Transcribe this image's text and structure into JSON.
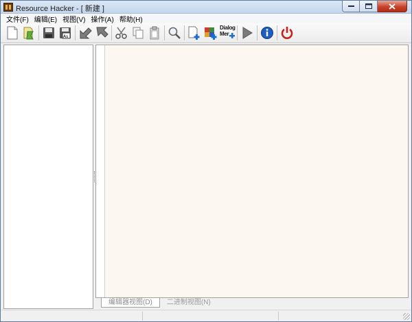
{
  "window": {
    "title": "Resource Hacker - [ 新建 ]"
  },
  "menu": [
    {
      "label": "文件(F)"
    },
    {
      "label": "编辑(E)"
    },
    {
      "label": "视图(V)"
    },
    {
      "label": "操作(A)"
    },
    {
      "label": "帮助(H)"
    }
  ],
  "toolbar": {
    "dialog_menu_line1": "Dialog",
    "dialog_menu_line2": "Mer",
    "icons": [
      "new-file-icon",
      "open-file-icon",
      "save-icon",
      "save-as-icon",
      "back-arrow-icon",
      "forward-arrow-icon",
      "cut-icon",
      "copy-icon",
      "paste-icon",
      "find-icon",
      "add-resource-icon",
      "add-image-icon",
      "dialog-menu-icon",
      "run-script-icon",
      "info-icon",
      "power-icon"
    ]
  },
  "tabs": [
    {
      "label": "编辑器视图(D)",
      "active": true
    },
    {
      "label": "二进制视图(N)",
      "active": false
    }
  ],
  "colors": {
    "editor_bg": "#fdf7f1",
    "info_blue": "#1c5fbf",
    "power_red": "#c8201a"
  }
}
